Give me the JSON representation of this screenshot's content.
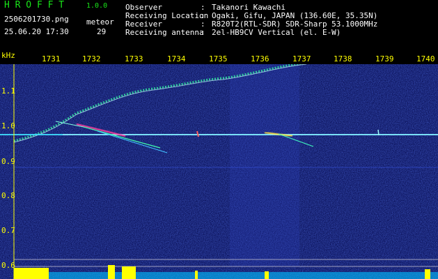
{
  "header": {
    "app_title": "H R O F F T",
    "version": "1.0.0",
    "filename": "2506201730.png",
    "datetime": "25.06.20 17:30",
    "meteor_label": "meteor",
    "meteor_count": "29"
  },
  "info": {
    "rows": [
      {
        "label": "Observer",
        "sep": ":",
        "value": "Takanori Kawachi"
      },
      {
        "label": "Receiving Location",
        "sep": ":",
        "value": "Ogaki, Gifu, JAPAN (136.60E, 35.35N)"
      },
      {
        "label": "Receiver",
        "sep": ":",
        "value": "R820T2(RTL-SDR) SDR-Sharp 53.1000MHz"
      },
      {
        "label": "Receiving antenna",
        "sep": ":",
        "value": "2el-HB9CV Vertical (el. E-W)"
      }
    ]
  },
  "axes": {
    "unit": "kHz",
    "x_ticks": [
      "1731",
      "1732",
      "1733",
      "1734",
      "1735",
      "1736",
      "1737",
      "1738",
      "1739",
      "1740"
    ],
    "y_ticks": [
      "1.1",
      "1.0",
      "0.9",
      "0.8",
      "0.7",
      "0.6"
    ]
  },
  "colors": {
    "background": "#000000",
    "title_green": "#19e619",
    "axis_yellow": "#ffff00",
    "noise_blue": "#1a2aa0",
    "carrier_cyan": "#40e0ff"
  }
}
